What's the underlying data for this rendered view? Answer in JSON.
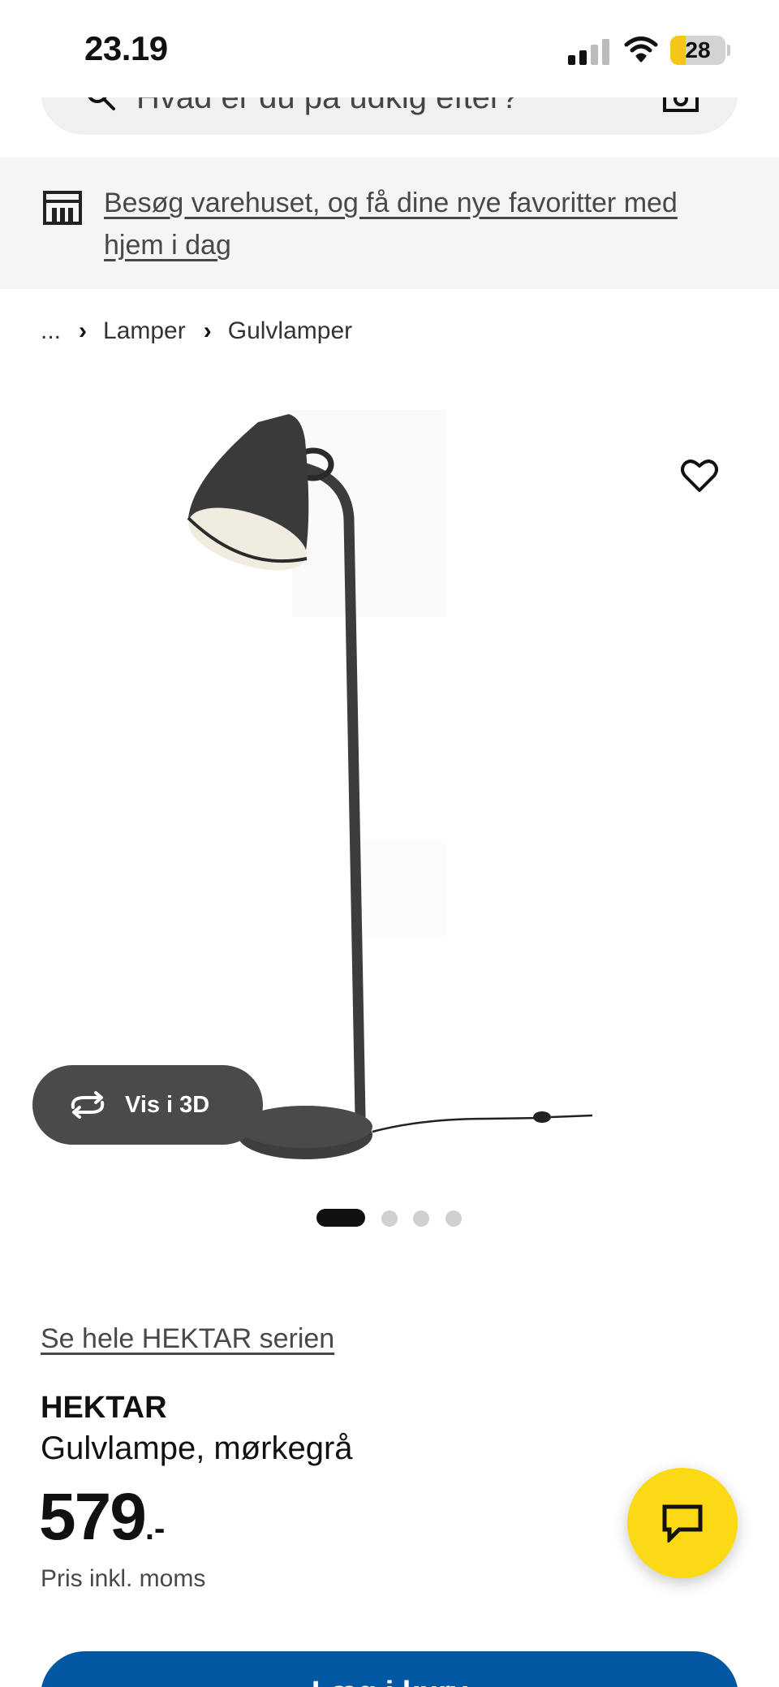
{
  "status_bar": {
    "time": "23.19",
    "battery_level": "28",
    "battery_fraction": 0.28
  },
  "search": {
    "placeholder": "Hvad er du på udkig efter?"
  },
  "store_banner": {
    "text": "Besøg varehuset, og få dine nye favoritter med hjem i dag"
  },
  "breadcrumb": {
    "ellipsis": "...",
    "items": [
      "Lamper",
      "Gulvlamper"
    ]
  },
  "gallery": {
    "vis_3d_label": "Vis i 3D",
    "image_count": 4,
    "active_index": 0
  },
  "product": {
    "series_link": "Se hele HEKTAR serien",
    "name": "HEKTAR",
    "description": "Gulvlampe, mørkegrå",
    "price": "579",
    "price_suffix": ".-",
    "price_note": "Pris inkl. moms"
  },
  "cta": {
    "label": "Læg i kurv"
  },
  "colors": {
    "accent_yellow": "#fbd914",
    "primary_blue": "#0058a3",
    "banner_bg": "#f5f5f5",
    "dark_pill": "#4a4a4a"
  },
  "icons": [
    "search-icon",
    "camera-icon",
    "store-icon",
    "chevron-right-icon",
    "heart-icon",
    "rotate-3d-icon",
    "chat-icon",
    "signal-icon",
    "wifi-icon",
    "battery-icon"
  ]
}
